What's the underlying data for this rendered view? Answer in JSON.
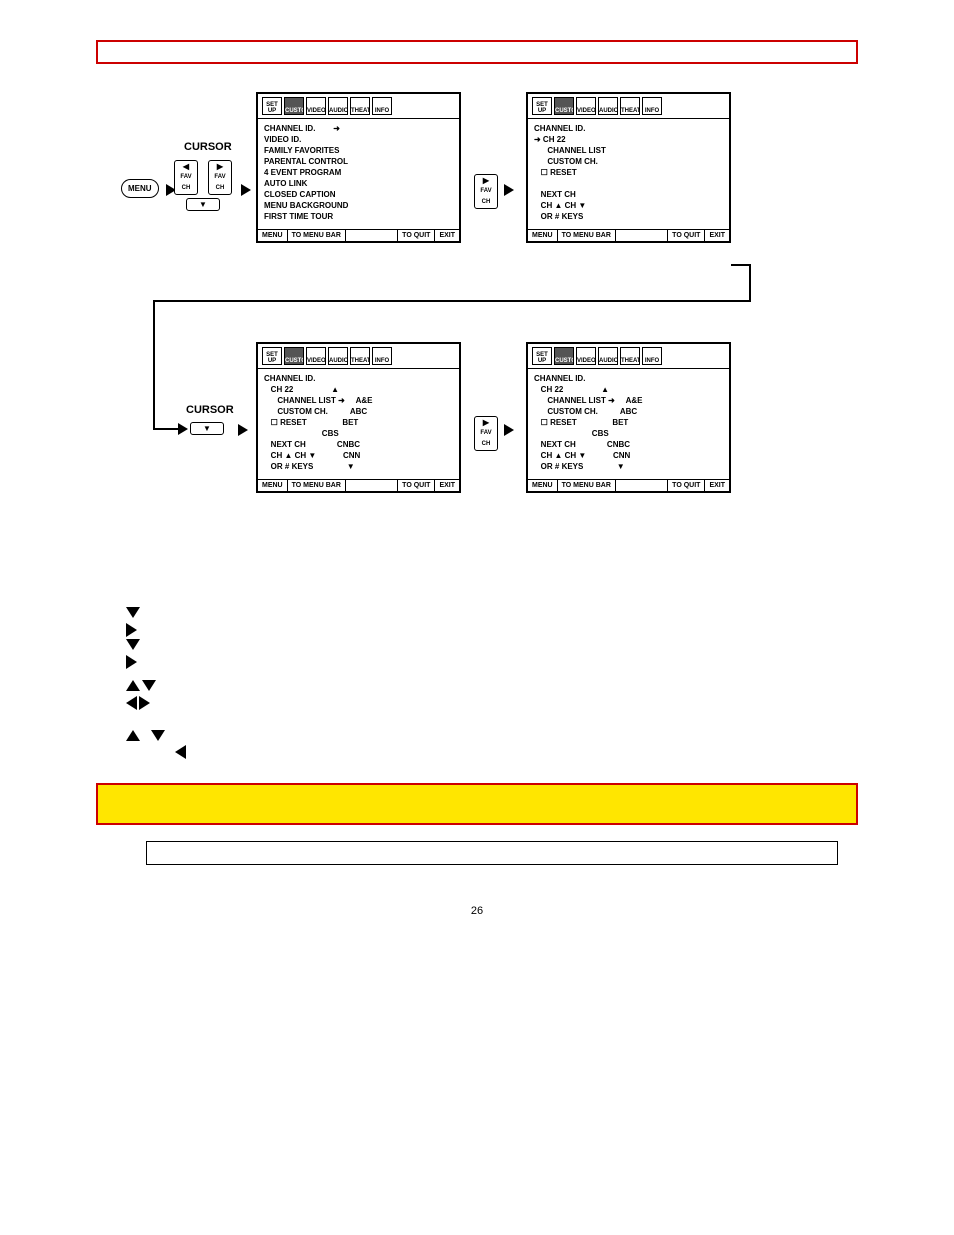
{
  "header": {
    "title": ""
  },
  "diagram": {
    "menu_key": "MENU",
    "cursor_label_top": "CURSOR",
    "cursor_label_bottom": "CURSOR",
    "fav_key": "FAV\nCH"
  },
  "osd_tabs": [
    "SET UP",
    "CUSTOM",
    "VIDEO",
    "AUDIO",
    "THEATER",
    "INFO"
  ],
  "osd_footer": {
    "menu": "MENU",
    "to_bar": "TO MENU BAR",
    "to_quit": "TO QUIT",
    "exit": "EXIT"
  },
  "screen1": {
    "title": "CHANNEL ID.",
    "arrow_item": "➜",
    "items": [
      "VIDEO ID.",
      "FAMILY FAVORITES",
      "PARENTAL CONTROL",
      "4 EVENT PROGRAM",
      "AUTO LINK",
      "CLOSED CAPTION",
      "MENU BACKGROUND",
      "FIRST TIME TOUR"
    ]
  },
  "screen2": {
    "title": "CHANNEL ID.",
    "ch_line": "➜ CH 22",
    "sub1": "CHANNEL LIST",
    "sub2": "CUSTOM CH.",
    "reset": "☐ RESET",
    "hint1": "NEXT CH",
    "hint2": "CH ▲ CH ▼",
    "hint3": "OR # KEYS"
  },
  "screen3": {
    "title": "CHANNEL ID.",
    "ch_line": "CH 22",
    "sel": "CHANNEL LIST ➜",
    "sub2": "CUSTOM CH.",
    "reset": "☐ RESET",
    "hint1": "NEXT CH",
    "hint2": "CH ▲ CH ▼",
    "hint3": "OR # KEYS",
    "list_top": "▲",
    "list": [
      "A&E",
      "ABC",
      "BET",
      "CBS",
      "CNBC",
      "CNN"
    ],
    "list_bot": "▼"
  },
  "screen4": {
    "title": "CHANNEL ID.",
    "ch_line": "CH 22",
    "sel": "CHANNEL LIST ➜",
    "sub2": "CUSTOM CH.",
    "reset": "☐ RESET",
    "hint1": "NEXT CH",
    "hint2": "CH ▲ CH ▼",
    "hint3": "OR # KEYS",
    "list_top": "▲",
    "list": [
      "A&E",
      "ABC",
      "BET",
      "CBS",
      "CNBC",
      "CNN"
    ],
    "list_bot": "▼"
  },
  "steps": {
    "s1": "",
    "s2": "",
    "s3": "",
    "s4": "",
    "s5": "",
    "s6": "",
    "s7a": "",
    "s7b": "",
    "s8": "",
    "s9a": "",
    "s9b": ""
  },
  "yellowbar": {
    "text": ""
  },
  "notebox": {
    "text": ""
  },
  "page_number": "26"
}
